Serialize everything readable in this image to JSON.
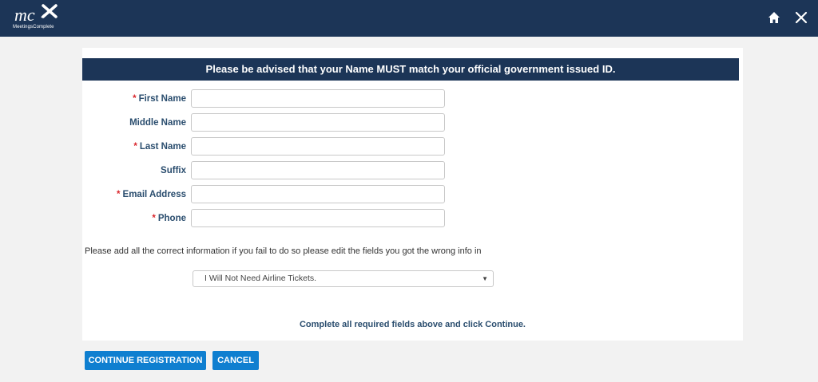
{
  "header": {
    "logo_text": "MeetingsComplete",
    "icons": [
      "home-icon",
      "close-icon"
    ],
    "bg_color": "#1c3557"
  },
  "form": {
    "notice": "Please be advised that your Name MUST match your official government issued ID.",
    "fields": [
      {
        "label": "First Name",
        "required": "*",
        "value": ""
      },
      {
        "label": "Middle Name",
        "required": "",
        "value": ""
      },
      {
        "label": "Last Name",
        "required": "*",
        "value": ""
      },
      {
        "label": "Suffix",
        "required": "",
        "value": ""
      },
      {
        "label": "Email Address",
        "required": "*",
        "value": ""
      },
      {
        "label": "Phone",
        "required": "*",
        "value": ""
      }
    ],
    "info_text": "Please add all the correct information if you fail to do so please edit the fields you got the wrong info in",
    "airline_select": {
      "selected": "I Will Not Need Airline Tickets."
    },
    "complete_message": "Complete all required fields above and click Continue."
  },
  "buttons": {
    "continue_label": "CONTINUE REGISTRATION",
    "cancel_label": "CANCEL",
    "color": "#0f7fd0"
  }
}
